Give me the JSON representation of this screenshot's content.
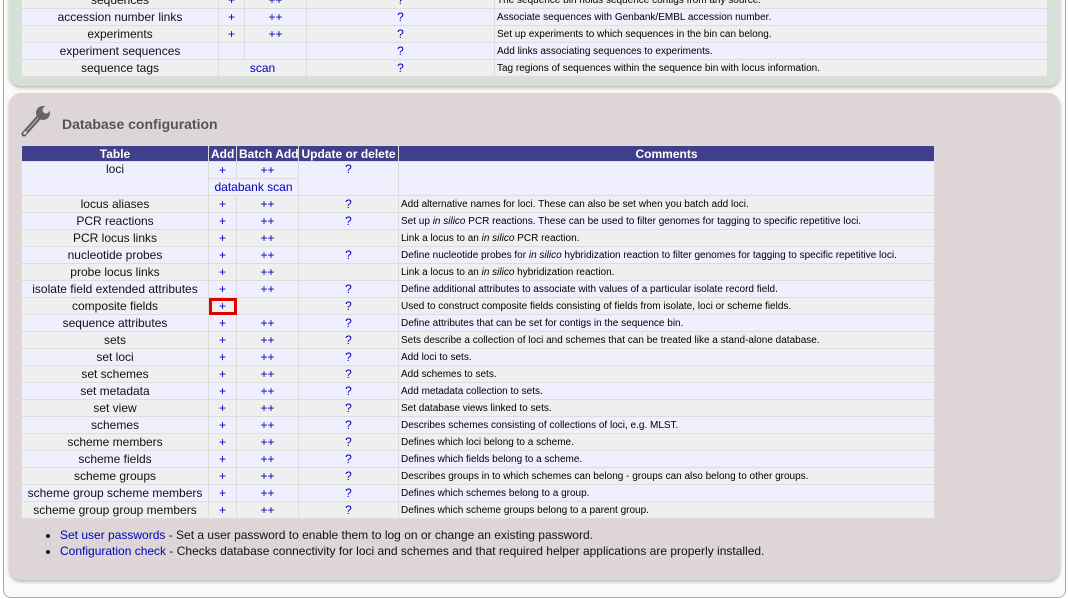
{
  "seqbin": {
    "rows": [
      {
        "table": "sequences",
        "add": "+",
        "batch": "++",
        "update": "?",
        "comment": [
          {
            "t": "The sequence bin holds sequence contigs from any source."
          }
        ]
      },
      {
        "table": "accession number links",
        "add": "+",
        "batch": "++",
        "update": "?",
        "comment": [
          {
            "t": "Associate sequences with Genbank/EMBL accession number."
          }
        ]
      },
      {
        "table": "experiments",
        "add": "+",
        "batch": "++",
        "update": "?",
        "comment": [
          {
            "t": "Set up experiments to which sequences in the bin can belong."
          }
        ]
      },
      {
        "table": "experiment sequences",
        "add": "",
        "batch": "",
        "update": "?",
        "comment": [
          {
            "t": "Add links associating sequences to experiments."
          }
        ]
      },
      {
        "table": "sequence tags",
        "scan": "scan",
        "update": "?",
        "comment": [
          {
            "t": "Tag regions of sequences within the sequence bin with locus information."
          }
        ]
      }
    ]
  },
  "db": {
    "title": "Database configuration",
    "icon": "wrench-icon",
    "headers": [
      "Table",
      "Add",
      "Batch Add",
      "Update or delete",
      "Comments"
    ],
    "loci": {
      "table": "loci",
      "add": "+",
      "batch": "++",
      "update": "?",
      "extra": "databank scan"
    },
    "rows": [
      {
        "table": "locus aliases",
        "add": "+",
        "batch": "++",
        "update": "?",
        "comment": [
          {
            "t": "Add alternative names for loci. These can also be set when you batch add loci."
          }
        ]
      },
      {
        "table": "PCR reactions",
        "add": "+",
        "batch": "++",
        "update": "?",
        "comment": [
          {
            "t": "Set up "
          },
          {
            "t": "in silico",
            "i": true
          },
          {
            "t": " PCR reactions. These can be used to filter genomes for tagging to specific repetitive loci."
          }
        ]
      },
      {
        "table": "PCR locus links",
        "add": "+",
        "batch": "++",
        "update": "",
        "comment": [
          {
            "t": "Link a locus to an "
          },
          {
            "t": "in silico",
            "i": true
          },
          {
            "t": " PCR reaction."
          }
        ]
      },
      {
        "table": "nucleotide probes",
        "add": "+",
        "batch": "++",
        "update": "?",
        "comment": [
          {
            "t": "Define nucleotide probes for "
          },
          {
            "t": "in silico",
            "i": true
          },
          {
            "t": " hybridization reaction to filter genomes for tagging to specific repetitive loci."
          }
        ]
      },
      {
        "table": "probe locus links",
        "add": "+",
        "batch": "++",
        "update": "",
        "comment": [
          {
            "t": "Link a locus to an "
          },
          {
            "t": "in silico",
            "i": true
          },
          {
            "t": " hybridization reaction."
          }
        ]
      },
      {
        "table": "isolate field extended attributes",
        "add": "+",
        "batch": "++",
        "update": "?",
        "comment": [
          {
            "t": "Define additional attributes to associate with values of a particular isolate record field."
          }
        ]
      },
      {
        "table": "composite fields",
        "add": "+",
        "batch": "",
        "update": "?",
        "highlight": true,
        "comment": [
          {
            "t": "Used to construct composite fields consisting of fields from isolate, loci or scheme fields."
          }
        ]
      },
      {
        "table": "sequence attributes",
        "add": "+",
        "batch": "++",
        "update": "?",
        "comment": [
          {
            "t": "Define attributes that can be set for contigs in the sequence bin."
          }
        ]
      },
      {
        "table": "sets",
        "add": "+",
        "batch": "++",
        "update": "?",
        "comment": [
          {
            "t": "Sets describe a collection of loci and schemes that can be treated like a stand-alone database."
          }
        ]
      },
      {
        "table": "set loci",
        "add": "+",
        "batch": "++",
        "update": "?",
        "comment": [
          {
            "t": "Add loci to sets."
          }
        ]
      },
      {
        "table": "set schemes",
        "add": "+",
        "batch": "++",
        "update": "?",
        "comment": [
          {
            "t": "Add schemes to sets."
          }
        ]
      },
      {
        "table": "set metadata",
        "add": "+",
        "batch": "++",
        "update": "?",
        "comment": [
          {
            "t": "Add metadata collection to sets."
          }
        ]
      },
      {
        "table": "set view",
        "add": "+",
        "batch": "++",
        "update": "?",
        "comment": [
          {
            "t": "Set database views linked to sets."
          }
        ]
      },
      {
        "table": "schemes",
        "add": "+",
        "batch": "++",
        "update": "?",
        "comment": [
          {
            "t": "Describes schemes consisting of collections of loci, e.g. MLST."
          }
        ]
      },
      {
        "table": "scheme members",
        "add": "+",
        "batch": "++",
        "update": "?",
        "comment": [
          {
            "t": "Defines which loci belong to a scheme."
          }
        ]
      },
      {
        "table": "scheme fields",
        "add": "+",
        "batch": "++",
        "update": "?",
        "comment": [
          {
            "t": "Defines which fields belong to a scheme."
          }
        ]
      },
      {
        "table": "scheme groups",
        "add": "+",
        "batch": "++",
        "update": "?",
        "comment": [
          {
            "t": "Describes groups in to which schemes can belong - groups can also belong to other groups."
          }
        ]
      },
      {
        "table": "scheme group scheme members",
        "add": "+",
        "batch": "++",
        "update": "?",
        "comment": [
          {
            "t": "Defines which schemes belong to a group."
          }
        ]
      },
      {
        "table": "scheme group group members",
        "add": "+",
        "batch": "++",
        "update": "?",
        "comment": [
          {
            "t": "Defines which scheme groups belong to a parent group."
          }
        ]
      }
    ],
    "links": [
      {
        "label": "Set user passwords",
        "desc": " - Set a user password to enable them to log on or change an existing password."
      },
      {
        "label": "Configuration check",
        "desc": " - Checks database connectivity for loci and schemes and that required helper applications are properly installed."
      }
    ]
  }
}
